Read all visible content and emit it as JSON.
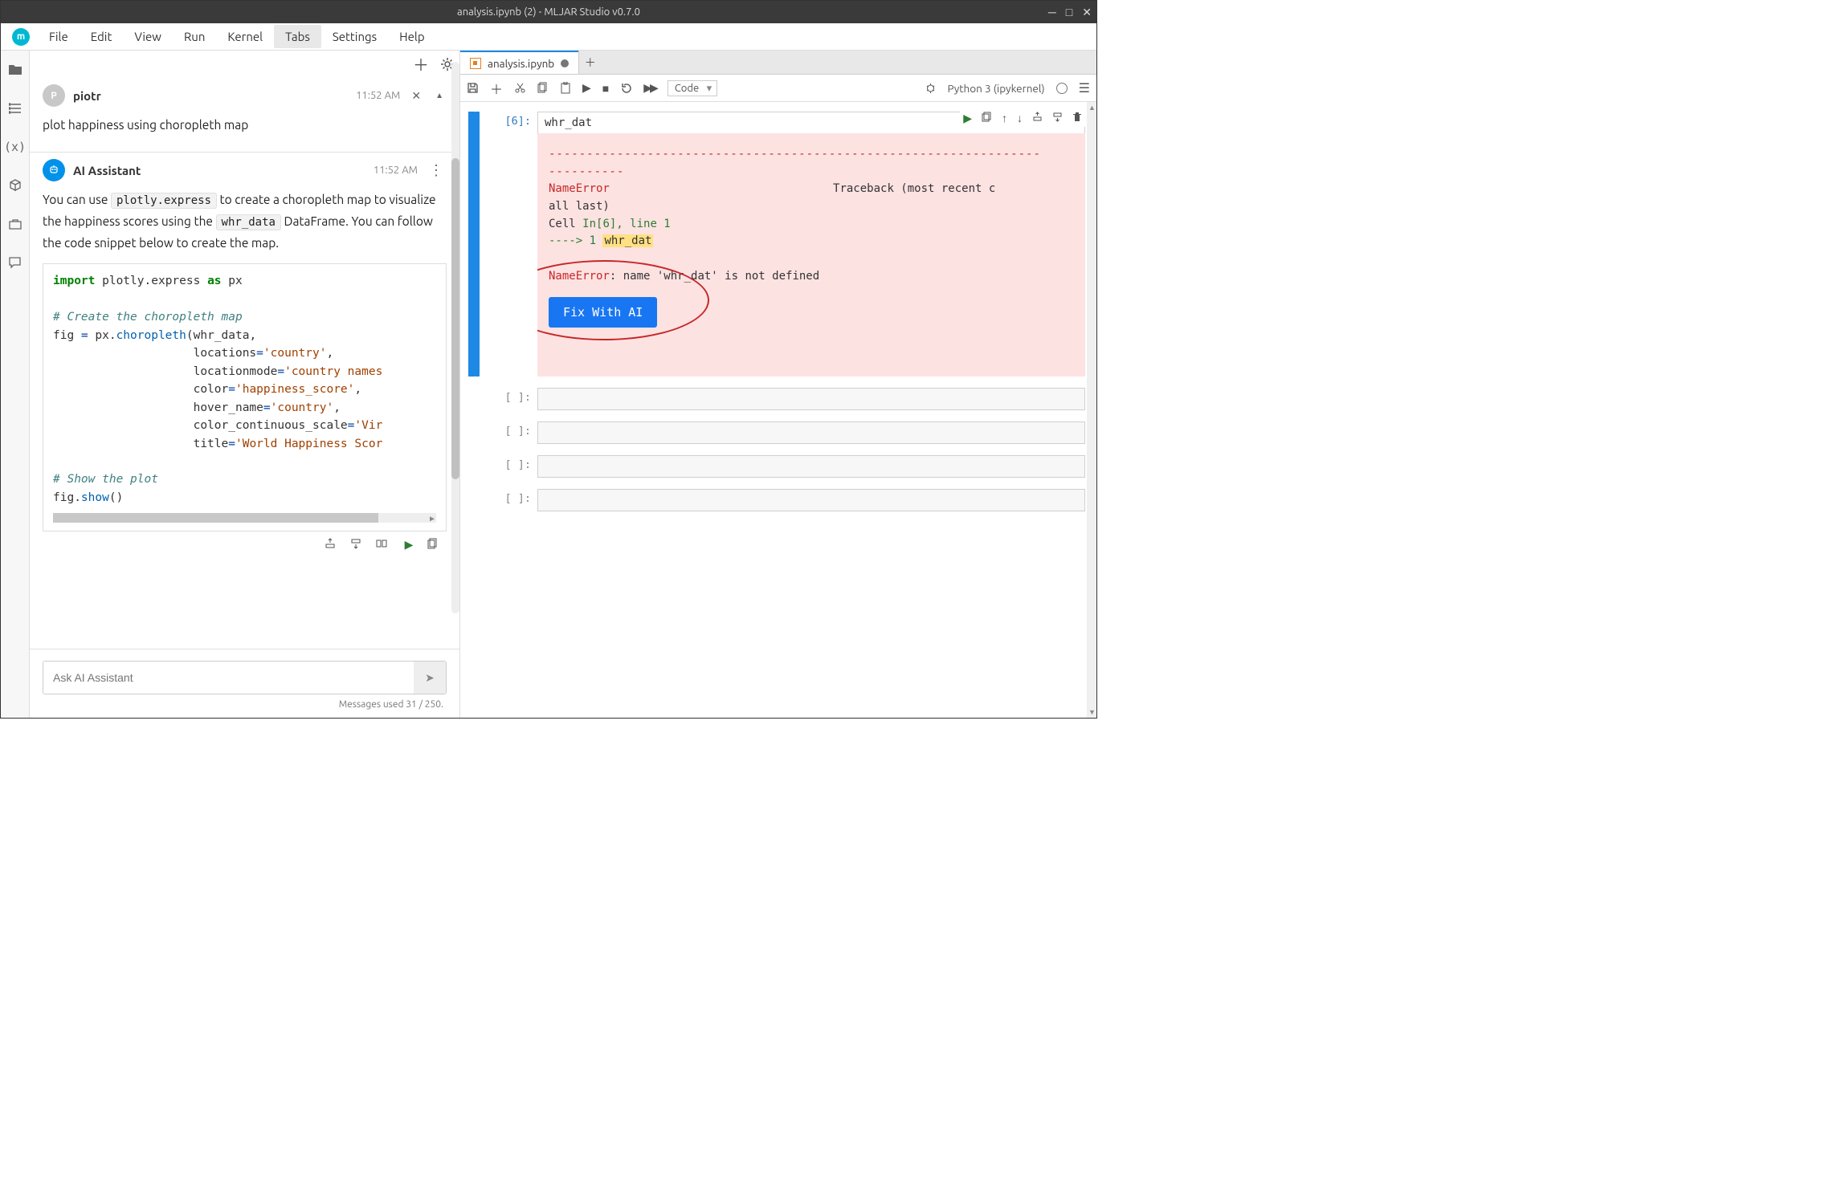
{
  "window": {
    "title": "analysis.ipynb (2) - MLJAR Studio v0.7.0"
  },
  "menubar": {
    "items": [
      "File",
      "Edit",
      "View",
      "Run",
      "Kernel",
      "Tabs",
      "Settings",
      "Help"
    ],
    "active": "Tabs"
  },
  "chat": {
    "user": {
      "name": "piotr",
      "initial": "P",
      "time": "11:52 AM",
      "text": "plot happiness using choropleth map"
    },
    "ai": {
      "name": "AI Assistant",
      "time": "11:52 AM",
      "text_pre": "You can use ",
      "inline1": "plotly.express",
      "text_mid": " to create a choropleth map to visualize the happiness scores using the ",
      "inline2": "whr_data",
      "text_post": " DataFrame. You can follow the code snippet below to create the map."
    },
    "code": {
      "l1": "import",
      "l1b": " plotly.express ",
      "l1c": "as",
      "l1d": " px",
      "c1": "# Create the choropleth map",
      "l2a": "fig ",
      "l2b": "=",
      "l2c": " px.",
      "l2d": "choropleth",
      "l2e": "(whr_data,",
      "l3a": "                    locations",
      "l3b": "=",
      "l3c": "'country'",
      "l3d": ",",
      "l4a": "                    locationmode",
      "l4b": "=",
      "l4c": "'country names",
      "l5a": "                    color",
      "l5b": "=",
      "l5c": "'happiness_score'",
      "l5d": ",",
      "l6a": "                    hover_name",
      "l6b": "=",
      "l6c": "'country'",
      "l6d": ",",
      "l7a": "                    color_continuous_scale",
      "l7b": "=",
      "l7c": "'Vir",
      "l8a": "                    title",
      "l8b": "=",
      "l8c": "'World Happiness Scor",
      "c2": "# Show the plot",
      "l9a": "fig.",
      "l9b": "show",
      "l9c": "()"
    },
    "input_placeholder": "Ask AI Assistant",
    "status": "Messages used 31 / 250."
  },
  "notebook": {
    "tab_label": "analysis.ipynb",
    "celltype": "Code",
    "kernel": "Python 3 (ipykernel)",
    "cell6_prompt": "[6]:",
    "cell6_code": "whr_dat",
    "empty_prompt": "[ ]:",
    "error": {
      "dash_long": "-----------------------------------------------------------------",
      "dash_short": "----------",
      "name": "NameError",
      "traceback": "Traceback (most recent c",
      "line2": "all last)",
      "line3a": "Cell ",
      "line3b": "In[6], line 1",
      "line4a": "----> ",
      "line4b": "1 ",
      "line4c": "whr_dat",
      "final_a": "NameError",
      "final_b": ": name ",
      "final_c": "'whr_dat'",
      "final_d": " is not defined",
      "fix_btn": "Fix With AI"
    }
  }
}
